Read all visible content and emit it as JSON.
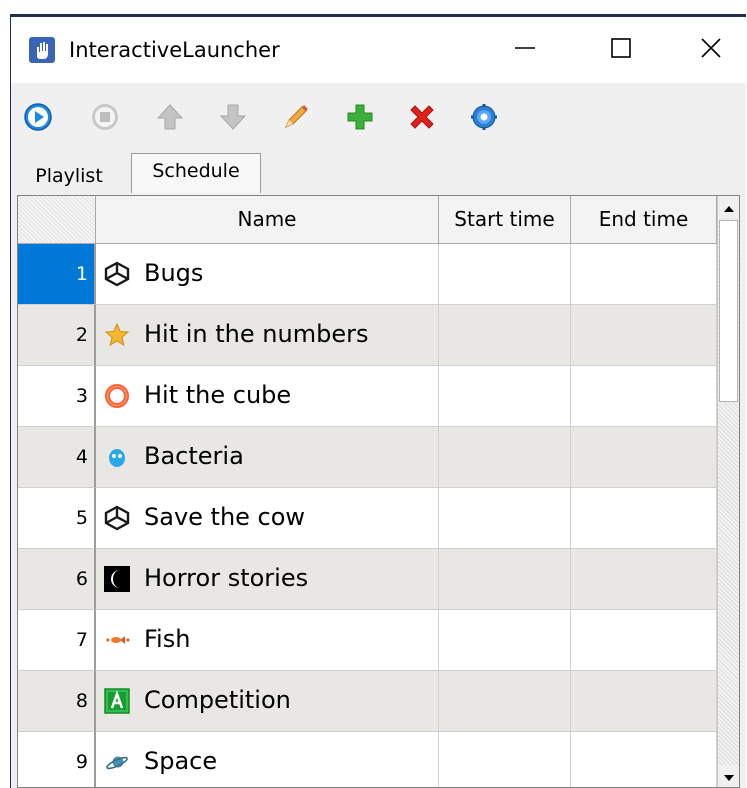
{
  "window": {
    "title": "InteractiveLauncher",
    "icon": "hand-app-icon",
    "controls": [
      "minimize-icon",
      "maximize-icon",
      "close-icon"
    ]
  },
  "toolbar": {
    "buttons": [
      {
        "icon": "play-icon",
        "color": "#1e88e5"
      },
      {
        "icon": "stop-icon",
        "color": "#b5b5b5"
      },
      {
        "icon": "arrow-up-icon",
        "color": "#b5b5b5"
      },
      {
        "icon": "arrow-down-icon",
        "color": "#b5b5b5"
      },
      {
        "icon": "pencil-icon",
        "color": "#f2a93b"
      },
      {
        "icon": "plus-icon",
        "color": "#3cb03c"
      },
      {
        "icon": "delete-icon",
        "color": "#e0201b"
      },
      {
        "icon": "gear-icon",
        "color": "#2a7fd4"
      }
    ]
  },
  "tabs": {
    "playlist": "Playlist",
    "schedule": "Schedule",
    "active": "Schedule"
  },
  "table": {
    "columns": [
      "Name",
      "Start time",
      "End time"
    ],
    "selected_row": 1,
    "rows": [
      {
        "num": "1",
        "name": "Bugs",
        "icon": "unity-icon",
        "start": "",
        "end": ""
      },
      {
        "num": "2",
        "name": "Hit in the numbers",
        "icon": "star-icon",
        "start": "",
        "end": ""
      },
      {
        "num": "3",
        "name": "Hit the cube",
        "icon": "ring-icon",
        "start": "",
        "end": ""
      },
      {
        "num": "4",
        "name": "Bacteria",
        "icon": "blob-icon",
        "start": "",
        "end": ""
      },
      {
        "num": "5",
        "name": "Save the cow",
        "icon": "unity-icon",
        "start": "",
        "end": ""
      },
      {
        "num": "6",
        "name": "Horror stories",
        "icon": "moon-icon",
        "start": "",
        "end": ""
      },
      {
        "num": "7",
        "name": "Fish",
        "icon": "fish-icon",
        "start": "",
        "end": ""
      },
      {
        "num": "8",
        "name": "Competition",
        "icon": "letter-a-icon",
        "start": "",
        "end": ""
      },
      {
        "num": "9",
        "name": "Space",
        "icon": "planet-icon",
        "start": "",
        "end": ""
      }
    ]
  },
  "colors": {
    "selection": "#0078d7",
    "alt_row": "#e9e7e3"
  }
}
